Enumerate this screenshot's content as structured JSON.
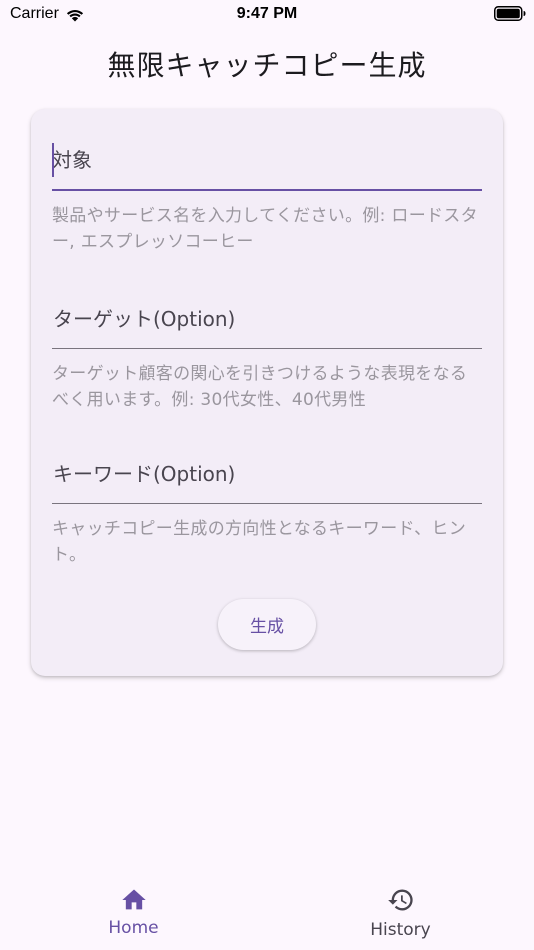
{
  "status_bar": {
    "carrier": "Carrier",
    "time": "9:47 PM"
  },
  "app": {
    "title": "無限キャッチコピー生成"
  },
  "form": {
    "target_object": {
      "label": "対象",
      "value": "",
      "helper": "製品やサービス名を入力してください。例: ロードスター, エスプレッソコーヒー"
    },
    "target_audience": {
      "label": "ターゲット(Option)",
      "value": "",
      "helper": "ターゲット顧客の関心を引きつけるような表現をなるべく用います。例: 30代女性、40代男性"
    },
    "keywords": {
      "label": "キーワード(Option)",
      "value": "",
      "helper": "キャッチコピー生成の方向性となるキーワード、ヒント。"
    },
    "generate_label": "生成"
  },
  "bottom_nav": {
    "items": [
      {
        "label": "Home",
        "icon": "home-icon",
        "selected": true
      },
      {
        "label": "History",
        "icon": "history-icon",
        "selected": false
      }
    ]
  },
  "colors": {
    "primary": "#6750a4",
    "background": "#fdf7fe",
    "card": "#f3edf7",
    "helper_text": "#9a969e"
  }
}
